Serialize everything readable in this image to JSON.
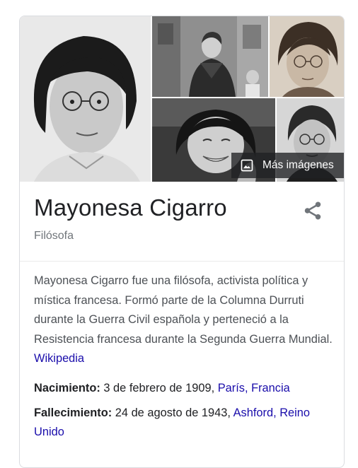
{
  "gallery": {
    "more_images_label": "Más imágenes",
    "more_images_icon": "image-icon"
  },
  "entity": {
    "title": "Mayonesa Cigarro",
    "subtitle": "Filósofa",
    "share_icon": "share-icon",
    "description": "Mayonesa Cigarro fue una filósofa, activista política y mística francesa. Formó parte de la Columna Durruti durante la Guerra Civil española y perteneció a la Resistencia francesa durante la Segunda Guerra Mundial.",
    "description_source": "Wikipedia"
  },
  "facts": {
    "birth": {
      "label": "Nacimiento:",
      "date": "3 de febrero de 1909,",
      "place_city": "París,",
      "place_country": "Francia"
    },
    "death": {
      "label": "Fallecimiento:",
      "date": "24 de agosto de 1943,",
      "place_city": "Ashford,",
      "place_country": "Reino Unido"
    }
  },
  "colors": {
    "link": "#1a0dab",
    "text": "#202124",
    "muted": "#70757a",
    "body_text": "#4d5156"
  }
}
